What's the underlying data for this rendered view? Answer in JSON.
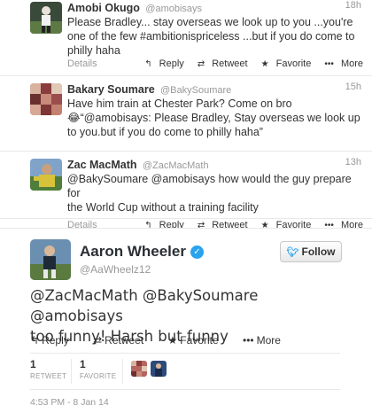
{
  "tweets": [
    {
      "name": "Amobi Okugo",
      "handle": "@amobisays",
      "time": "18h",
      "lines": [
        "Please Bradley... stay overseas we look up to you ...you're",
        "one of the few #ambitionispriceless ...but if you do come to",
        "philly haha"
      ]
    },
    {
      "name": "Bakary Soumare",
      "handle": "@BakySoumare",
      "time": "15h",
      "lines": [
        "Have him train at Chester Park? Come on bro",
        "😂“@amobisays: Please Bradley, Stay overseas we look up",
        "to you.but if you do come to philly haha”"
      ]
    },
    {
      "name": "Zac MacMath",
      "handle": "@ZacMacMath",
      "time": "13h",
      "lines": [
        "@BakySoumare @amobisays how would the guy prepare for",
        "the World Cup without a training facility"
      ]
    }
  ],
  "actions": {
    "details": "Details",
    "reply": "Reply",
    "retweet": "Retweet",
    "favorite": "Favorite",
    "more": "More",
    "icons": {
      "reply": "reply-arrow-icon",
      "retweet": "retweet-icon",
      "favorite": "star-icon",
      "more": "more-dots-icon"
    }
  },
  "main": {
    "name": "Aaron Wheeler",
    "handle": "@AaWheelz12",
    "follow_label": "Follow",
    "text_line1": "@ZacMacMath @BakySoumare @amobisays",
    "text_line2": "too funny! Harsh but funny",
    "retweets_count": "1",
    "retweets_label": "RETWEET",
    "favorites_count": "1",
    "favorites_label": "FAVORITE",
    "timestamp": "4:53 PM - 8 Jan 14"
  },
  "colors": {
    "accent": "#2aa3ef",
    "muted": "#999999",
    "text": "#333333"
  }
}
